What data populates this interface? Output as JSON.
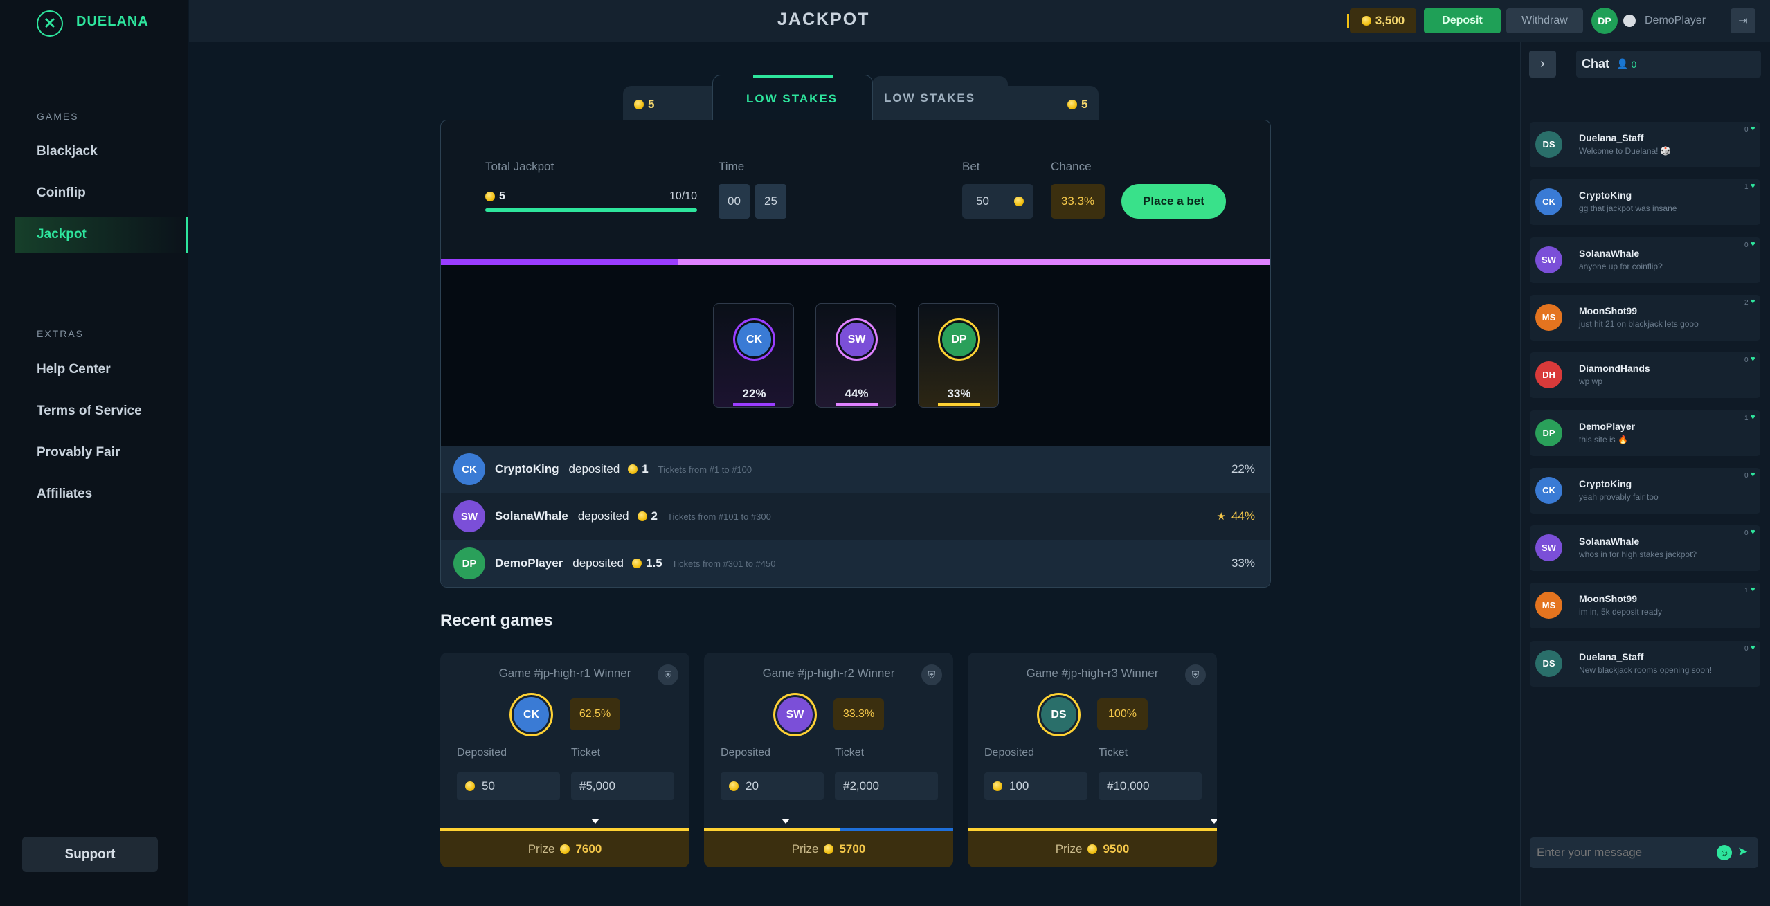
{
  "brand": {
    "name": "DUELANA",
    "mark": "✕"
  },
  "sidebar": {
    "games_title": "GAMES",
    "games": [
      {
        "label": "Blackjack"
      },
      {
        "label": "Coinflip"
      },
      {
        "label": "Jackpot"
      }
    ],
    "extras_title": "EXTRAS",
    "extras": [
      {
        "label": "Help Center"
      },
      {
        "label": "Terms of Service"
      },
      {
        "label": "Provably Fair"
      },
      {
        "label": "Affiliates"
      }
    ],
    "support": "Support"
  },
  "header": {
    "title": "JACKPOT",
    "balance": "3,500",
    "deposit": "Deposit",
    "withdraw": "Withdraw",
    "user_initials": "DP",
    "username": "DemoPlayer"
  },
  "tabs": {
    "left_value": "5",
    "active": "LOW STAKES",
    "inactive": "LOW STAKES",
    "right_value": "5"
  },
  "jackpot": {
    "total_label": "Total Jackpot",
    "total_value": "5",
    "total_count": "10/10",
    "time_label": "Time",
    "time_min": "00",
    "time_sec": "25",
    "bet_label": "Bet",
    "bet_value": "50",
    "chance_label": "Chance",
    "chance_value": "33.3%",
    "place_bet": "Place a bet",
    "progress": 1.0
  },
  "players": [
    {
      "initials": "CK",
      "pct": "22%",
      "color": "#3a7bd5",
      "ring": "#9b3dff"
    },
    {
      "initials": "SW",
      "pct": "44%",
      "color": "#7b4fd8",
      "ring": "#e082ff"
    },
    {
      "initials": "DP",
      "pct": "33%",
      "color": "#2aa05a",
      "ring": "#ffd233"
    }
  ],
  "deposits": [
    {
      "initials": "CK",
      "name": "CryptoKing",
      "verb": "deposited",
      "amount": "1",
      "tickets": "Tickets from #1 to #100",
      "pct": "22%",
      "star": ""
    },
    {
      "initials": "SW",
      "name": "SolanaWhale",
      "verb": "deposited",
      "amount": "2",
      "tickets": "Tickets from #101 to #300",
      "pct": "44%",
      "star": "★"
    },
    {
      "initials": "DP",
      "name": "DemoPlayer",
      "verb": "deposited",
      "amount": "1.5",
      "tickets": "Tickets from #301 to #450",
      "pct": "33%",
      "star": ""
    }
  ],
  "recent": {
    "title": "Recent games",
    "games": [
      {
        "title": "Game #jp-high-r1 Winner",
        "initials": "CK",
        "chance": "62.5%",
        "deposited_label": "Deposited",
        "deposited": "50",
        "ticket_label": "Ticket",
        "ticket": "#5,000",
        "prize_label": "Prize",
        "prize": "7600"
      },
      {
        "title": "Game #jp-high-r2 Winner",
        "initials": "SW",
        "chance": "33.3%",
        "deposited_label": "Deposited",
        "deposited": "20",
        "ticket_label": "Ticket",
        "ticket": "#2,000",
        "prize_label": "Prize",
        "prize": "5700"
      },
      {
        "title": "Game #jp-high-r3 Winner",
        "initials": "DS",
        "chance": "100%",
        "deposited_label": "Deposited",
        "deposited": "100",
        "ticket_label": "Ticket",
        "ticket": "#10,000",
        "prize_label": "Prize",
        "prize": "9500"
      }
    ]
  },
  "chat": {
    "title": "Chat",
    "online": "0",
    "placeholder": "Enter your message",
    "messages": [
      {
        "initials": "DS",
        "name": "Duelana_Staff",
        "text": "Welcome to Duelana! 🎲",
        "likes": "0",
        "color": "#2a6f6a"
      },
      {
        "initials": "CK",
        "name": "CryptoKing",
        "text": "gg that jackpot was insane",
        "likes": "1",
        "color": "#3a7bd5"
      },
      {
        "initials": "SW",
        "name": "SolanaWhale",
        "text": "anyone up for coinflip?",
        "likes": "0",
        "color": "#7b4fd8"
      },
      {
        "initials": "MS",
        "name": "MoonShot99",
        "text": "just hit 21 on blackjack lets gooo",
        "likes": "2",
        "color": "#e4741f"
      },
      {
        "initials": "DH",
        "name": "DiamondHands",
        "text": "wp wp",
        "likes": "0",
        "color": "#d93a3a"
      },
      {
        "initials": "DP",
        "name": "DemoPlayer",
        "text": "this site is 🔥",
        "likes": "1",
        "color": "#2aa05a"
      },
      {
        "initials": "CK",
        "name": "CryptoKing",
        "text": "yeah provably fair too",
        "likes": "0",
        "color": "#3a7bd5"
      },
      {
        "initials": "SW",
        "name": "SolanaWhale",
        "text": "whos in for high stakes jackpot?",
        "likes": "0",
        "color": "#7b4fd8"
      },
      {
        "initials": "MS",
        "name": "MoonShot99",
        "text": "im in, 5k deposit ready",
        "likes": "1",
        "color": "#e4741f"
      },
      {
        "initials": "DS",
        "name": "Duelana_Staff",
        "text": "New blackjack rooms opening soon!",
        "likes": "0",
        "color": "#2a6f6a"
      }
    ]
  }
}
